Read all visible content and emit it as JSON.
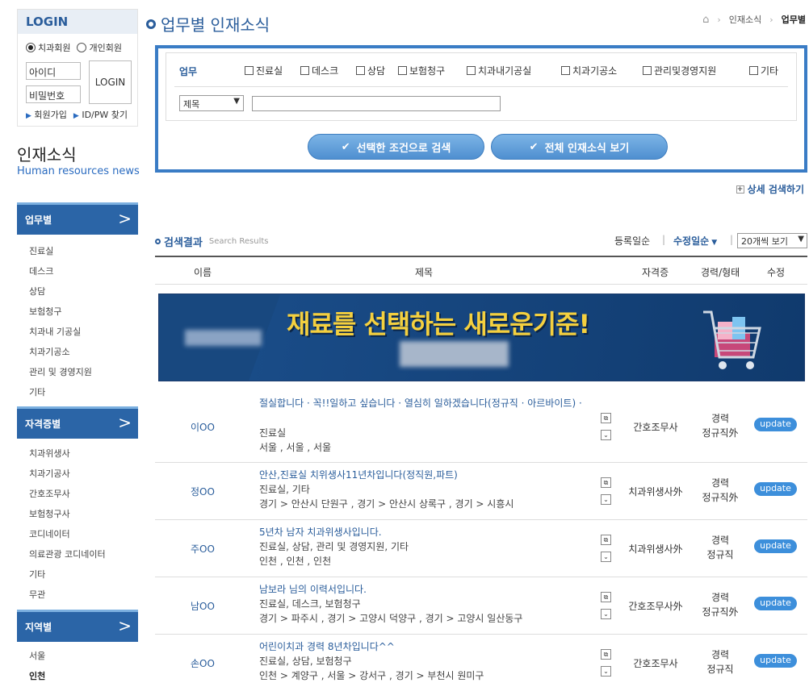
{
  "login": {
    "title": "LOGIN",
    "radio_member": "치과회원",
    "radio_personal": "개인회원",
    "id_placeholder": "아이디",
    "pw_placeholder": "비밀번호",
    "button": "LOGIN",
    "signup": "회원가입",
    "find": "ID/PW 찾기"
  },
  "section": {
    "title": "인재소식",
    "subtitle": "Human resources news"
  },
  "sidebar": {
    "cat1": {
      "label": "업무별",
      "items": [
        "진료실",
        "데스크",
        "상담",
        "보험청구",
        "치과내 기공실",
        "치과기공소",
        "관리 및 경영지원",
        "기타"
      ]
    },
    "cat2": {
      "label": "자격증별",
      "items": [
        "치과위생사",
        "치과기공사",
        "간호조무사",
        "보험청구사",
        "코디네이터",
        "의료관광 코디네이터",
        "기타",
        "무관"
      ]
    },
    "cat3": {
      "label": "지역별",
      "items": [
        "서울",
        "인천"
      ]
    }
  },
  "page": {
    "title": "업무별 인재소식"
  },
  "breadcrumb": {
    "item1": "인재소식",
    "current": "업무별"
  },
  "filter": {
    "job_label": "업무",
    "options": [
      "진료실",
      "데스크",
      "상담",
      "보험청구",
      "치과내기공실",
      "치과기공소",
      "관리및경영지원",
      "기타"
    ],
    "select_value": "제목",
    "btn_search": "선택한 조건으로 검색",
    "btn_all": "전체 인재소식 보기",
    "detail_search": "상세 검색하기"
  },
  "results": {
    "title": "검색결과",
    "subtitle": "Search Results",
    "sort_reg": "등록일순",
    "sort_mod": "수정일순",
    "per_page": "20개씩 보기",
    "headers": {
      "name": "이름",
      "title": "제목",
      "qual": "자격증",
      "career": "경력/형태",
      "update": "수정"
    }
  },
  "banner": {
    "headline": "재료를 선택하는 새로운기준!"
  },
  "rows": [
    {
      "name": "이OO",
      "title": "절실합니다 · 꼭!!일하고 싶습니다 · 열심히 일하겠습니다(정규직 · 아르바이트) ·",
      "field": "진료실",
      "region": "서울 , 서울 , 서울",
      "qual": "간호조무사",
      "career": "경력",
      "type": "정규직外",
      "update": "update"
    },
    {
      "name": "정OO",
      "title": "안산,진료실 치위생사11년차입니다(정직원,파트)",
      "field": "진료실, 기타",
      "region": "경기 > 안산시 단원구 , 경기 > 안산시 상록구 , 경기 > 시흥시",
      "qual": "치과위생사外",
      "career": "경력",
      "type": "정규직外",
      "update": "update"
    },
    {
      "name": "주OO",
      "title": "5년차 남자 치과위생사입니다.",
      "field": "진료실, 상담, 관리 및 경영지원, 기타",
      "region": "인천 , 인천 , 인천",
      "qual": "치과위생사外",
      "career": "경력",
      "type": "정규직",
      "update": "update"
    },
    {
      "name": "남OO",
      "title": "남보라 님의 이력서입니다.",
      "field": "진료실, 데스크, 보험청구",
      "region": "경기 > 파주시 , 경기 > 고양시 덕양구 , 경기 > 고양시 일산동구",
      "qual": "간호조무사外",
      "career": "경력",
      "type": "정규직外",
      "update": "update"
    },
    {
      "name": "손OO",
      "title": "어린이치과 경력 8년차입니다^^",
      "field": "진료실, 상담, 보험청구",
      "region": "인천 > 계양구 , 서울 > 강서구 , 경기 > 부천시 원미구",
      "qual": "간호조무사",
      "career": "경력",
      "type": "정규직",
      "update": "update"
    }
  ]
}
